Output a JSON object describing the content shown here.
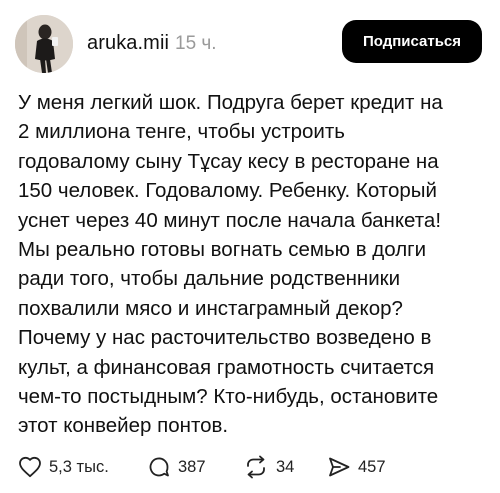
{
  "post": {
    "username": "aruka.mii",
    "time": "15 ч.",
    "follow_label": "Подписаться",
    "lines": [
      "У меня легкий шок. Подруга берет кредит на",
      "2 миллиона тенге, чтобы устроить",
      "годовалому сыну Тұсау кесу в ресторане на",
      "150 человек. Годовалому. Ребенку. Который",
      "уснет через 40 минут после начала банкета!",
      "Мы реально готовы вогнать семью в долги",
      "ради того, чтобы дальние родственники",
      "похвалили мясо и инстаграмный декор?",
      "Почему у нас расточительство возведено в",
      "культ, а финансовая грамотность считается",
      "чем-то постыдным? Кто-нибудь, остановите",
      "этот конвейер понтов."
    ],
    "actions": {
      "likes": "5,3 тыс.",
      "comments": "387",
      "reposts": "34",
      "shares": "457"
    },
    "icons": {
      "like": "heart-icon",
      "comment": "comment-bubble-icon",
      "repost": "repost-icon",
      "share": "share-send-icon"
    },
    "colors": {
      "follow_bg": "#000000",
      "follow_text": "#ffffff",
      "time_text": "#9a9a9a"
    }
  }
}
